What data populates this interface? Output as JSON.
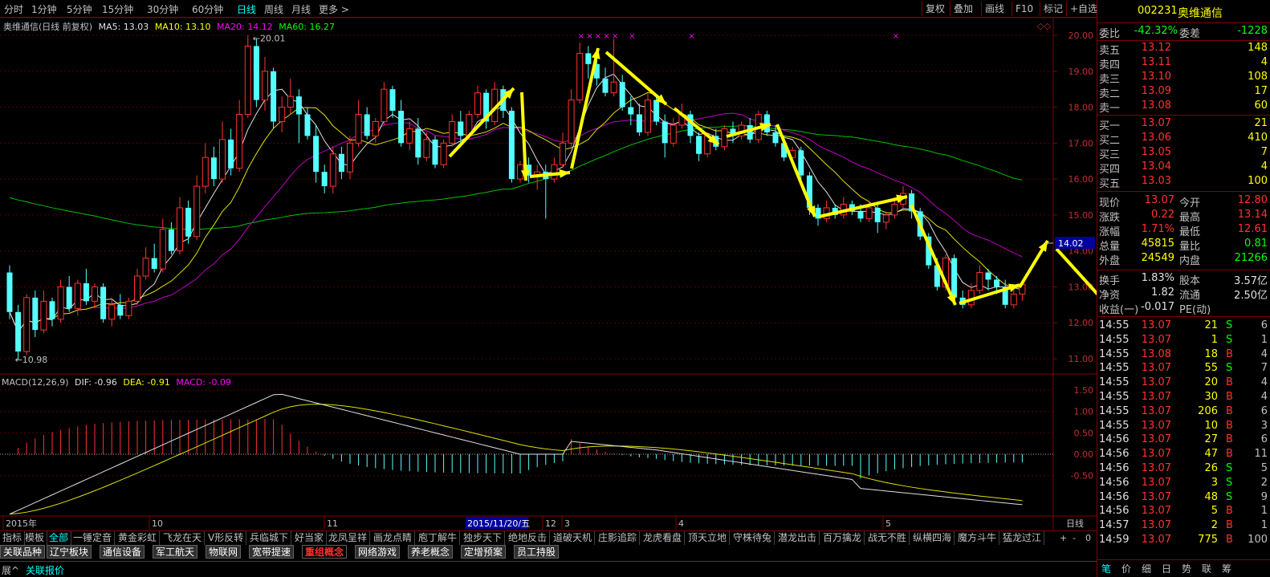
{
  "toolbar": {
    "periods": [
      "分时",
      "1分钟",
      "5分钟",
      "15分钟",
      "30分钟",
      "60分钟",
      "日线",
      "周线",
      "月线",
      "更多 >"
    ],
    "active": "日线",
    "right": [
      "复权",
      "叠加",
      "画线",
      "F10",
      "标记",
      "+自选"
    ]
  },
  "legend_main": {
    "name": "奥维通信(日线 前复权)",
    "ma5": "MA5: 13.03",
    "ma10": "MA10: 13.10",
    "ma20": "MA20: 14.12",
    "ma60": "MA60: 16.27"
  },
  "legend_macd": {
    "name": "MACD(12,26,9)",
    "dif": "DIF: -0.96",
    "dea": "DEA: -0.91",
    "macd": "MACD: -0.09"
  },
  "price_axis": [
    "20.00",
    "19.00",
    "18.00",
    "17.00",
    "16.00",
    "15.00",
    "14.00",
    "13.00",
    "12.00",
    "11.00"
  ],
  "macd_axis": [
    "1.50",
    "1.00",
    "0.50",
    "0.00",
    "-0.50"
  ],
  "cursor_price": "14.02",
  "chart_annotations": {
    "high": "20.01",
    "low": "10.98"
  },
  "date_axis": {
    "labels": [
      "2015年",
      "10",
      "11",
      "12",
      "3",
      "4",
      "5"
    ],
    "highlight": "2015/11/20/五",
    "period": "日线",
    "btns": [
      "+",
      "-",
      "0"
    ]
  },
  "chart_data": {
    "type": "candlestick",
    "price_range": [
      10.5,
      20.4
    ],
    "macd_range": [
      -1.2,
      1.75
    ],
    "candles": [
      [
        13.4,
        12.3,
        13.6,
        12.1
      ],
      [
        12.3,
        11.2,
        12.5,
        10.98
      ],
      [
        11.2,
        12.7,
        12.8,
        11.1
      ],
      [
        12.7,
        11.8,
        12.9,
        11.6
      ],
      [
        11.8,
        12.6,
        12.9,
        11.7
      ],
      [
        12.6,
        12.1,
        12.7,
        11.9
      ],
      [
        12.1,
        13.0,
        13.2,
        12.0
      ],
      [
        13.0,
        12.4,
        13.3,
        12.3
      ],
      [
        12.4,
        13.1,
        13.2,
        12.2
      ],
      [
        13.1,
        12.6,
        13.5,
        12.5
      ],
      [
        12.6,
        13.0,
        13.1,
        12.4
      ],
      [
        13.0,
        12.1,
        13.1,
        12.0
      ],
      [
        12.1,
        12.5,
        12.7,
        11.9
      ],
      [
        12.5,
        12.2,
        12.8,
        12.1
      ],
      [
        12.2,
        12.6,
        12.7,
        12.1
      ],
      [
        12.6,
        13.3,
        13.5,
        12.5
      ],
      [
        13.3,
        13.8,
        14.1,
        13.2
      ],
      [
        13.8,
        13.5,
        14.2,
        13.4
      ],
      [
        13.5,
        14.6,
        14.9,
        13.4
      ],
      [
        14.6,
        14.0,
        14.8,
        13.9
      ],
      [
        14.0,
        15.2,
        15.5,
        13.9
      ],
      [
        15.2,
        14.4,
        15.4,
        14.2
      ],
      [
        14.4,
        15.8,
        16.1,
        14.3
      ],
      [
        15.8,
        16.6,
        17.0,
        15.6
      ],
      [
        16.6,
        16.0,
        16.9,
        15.8
      ],
      [
        16.0,
        17.1,
        17.6,
        15.9
      ],
      [
        17.1,
        16.3,
        17.4,
        16.1
      ],
      [
        16.3,
        17.8,
        18.2,
        16.2
      ],
      [
        17.8,
        19.7,
        20.01,
        17.7
      ],
      [
        19.7,
        18.2,
        19.9,
        18.0
      ],
      [
        18.2,
        19.0,
        19.4,
        17.9
      ],
      [
        19.0,
        17.6,
        19.1,
        17.4
      ],
      [
        17.6,
        18.0,
        18.3,
        17.3
      ],
      [
        18.0,
        18.3,
        18.8,
        17.8
      ],
      [
        18.3,
        17.8,
        18.5,
        17.0
      ],
      [
        17.8,
        17.2,
        18.0,
        17.1
      ],
      [
        17.2,
        16.2,
        17.5,
        15.9
      ],
      [
        16.2,
        15.8,
        16.4,
        15.6
      ],
      [
        15.8,
        16.7,
        16.9,
        15.6
      ],
      [
        16.7,
        16.2,
        16.9,
        16.0
      ],
      [
        16.2,
        17.0,
        17.2,
        16.0
      ],
      [
        17.0,
        17.8,
        18.2,
        16.9
      ],
      [
        17.8,
        17.2,
        18.0,
        17.1
      ],
      [
        17.2,
        17.6,
        17.7,
        17.0
      ],
      [
        17.6,
        18.5,
        18.7,
        17.5
      ],
      [
        18.5,
        17.9,
        18.6,
        17.7
      ],
      [
        17.9,
        17.0,
        18.2,
        16.9
      ],
      [
        17.0,
        17.4,
        17.6,
        16.8
      ],
      [
        17.4,
        16.6,
        17.7,
        16.4
      ],
      [
        16.6,
        17.1,
        17.3,
        16.5
      ],
      [
        17.1,
        16.4,
        17.2,
        16.3
      ],
      [
        16.4,
        17.0,
        17.1,
        16.3
      ],
      [
        17.0,
        17.6,
        17.8,
        16.9
      ],
      [
        17.6,
        17.2,
        17.9,
        17.0
      ],
      [
        17.2,
        17.8,
        17.9,
        17.1
      ],
      [
        17.8,
        18.4,
        18.6,
        17.7
      ],
      [
        18.4,
        17.6,
        18.5,
        17.4
      ],
      [
        17.6,
        18.5,
        18.7,
        17.5
      ],
      [
        18.5,
        17.9,
        18.6,
        17.7
      ],
      [
        17.9,
        16.0,
        18.0,
        15.9
      ],
      [
        16.0,
        16.4,
        16.5,
        15.9
      ],
      [
        16.4,
        16.1,
        16.6,
        15.9
      ],
      [
        16.1,
        16.2,
        16.4,
        15.7
      ],
      [
        16.2,
        16.0,
        16.4,
        14.9
      ],
      [
        16.0,
        16.4,
        16.6,
        15.9
      ],
      [
        16.4,
        17.0,
        17.3,
        16.3
      ],
      [
        17.0,
        18.2,
        18.5,
        16.9
      ],
      [
        18.2,
        19.5,
        19.8,
        18.1
      ],
      [
        19.5,
        19.2,
        19.7,
        18.8
      ],
      [
        19.2,
        18.8,
        19.6,
        18.6
      ],
      [
        18.8,
        18.4,
        19.1,
        18.3
      ],
      [
        18.4,
        18.7,
        19.9,
        18.3
      ],
      [
        18.7,
        18.0,
        18.9,
        17.9
      ],
      [
        18.0,
        17.8,
        18.3,
        17.5
      ],
      [
        17.8,
        17.3,
        18.1,
        17.2
      ],
      [
        17.3,
        18.2,
        18.4,
        17.2
      ],
      [
        18.2,
        17.6,
        18.3,
        17.5
      ],
      [
        17.6,
        17.0,
        17.8,
        16.6
      ],
      [
        17.0,
        17.5,
        17.7,
        16.9
      ],
      [
        17.5,
        17.8,
        18.1,
        17.4
      ],
      [
        17.8,
        17.2,
        17.9,
        17.0
      ],
      [
        17.2,
        16.7,
        17.3,
        16.5
      ],
      [
        16.7,
        17.2,
        17.3,
        16.6
      ],
      [
        17.2,
        16.9,
        17.4,
        16.8
      ],
      [
        16.9,
        17.4,
        17.5,
        16.8
      ],
      [
        17.4,
        17.2,
        17.6,
        17.0
      ],
      [
        17.2,
        17.5,
        17.6,
        17.1
      ],
      [
        17.5,
        17.1,
        17.7,
        17.0
      ],
      [
        17.1,
        17.8,
        17.9,
        17.0
      ],
      [
        17.8,
        17.3,
        17.9,
        17.2
      ],
      [
        17.3,
        17.0,
        17.5,
        16.9
      ],
      [
        17.0,
        16.6,
        17.2,
        16.5
      ],
      [
        16.6,
        16.8,
        16.9,
        16.4
      ],
      [
        16.8,
        16.1,
        16.9,
        15.9
      ],
      [
        16.1,
        15.2,
        16.2,
        15.0
      ],
      [
        15.2,
        14.9,
        15.3,
        14.7
      ],
      [
        14.9,
        15.2,
        15.4,
        14.8
      ],
      [
        15.2,
        15.0,
        15.3,
        14.9
      ],
      [
        15.0,
        15.3,
        15.5,
        14.9
      ],
      [
        15.3,
        15.1,
        15.4,
        15.0
      ],
      [
        15.1,
        14.9,
        15.3,
        14.8
      ],
      [
        14.9,
        15.2,
        15.4,
        14.8
      ],
      [
        15.2,
        14.8,
        15.3,
        14.5
      ],
      [
        14.8,
        15.0,
        15.1,
        14.6
      ],
      [
        15.0,
        15.3,
        15.5,
        14.9
      ],
      [
        15.3,
        15.6,
        15.8,
        15.2
      ],
      [
        15.6,
        15.1,
        15.7,
        14.9
      ],
      [
        15.1,
        14.4,
        15.2,
        14.3
      ],
      [
        14.4,
        13.6,
        14.5,
        13.5
      ],
      [
        13.6,
        13.0,
        13.8,
        12.9
      ],
      [
        13.0,
        13.8,
        13.9,
        12.9
      ],
      [
        13.8,
        12.7,
        13.9,
        12.5
      ],
      [
        12.7,
        12.5,
        12.9,
        12.4
      ],
      [
        12.5,
        12.9,
        13.1,
        12.4
      ],
      [
        12.9,
        13.4,
        13.6,
        12.8
      ],
      [
        13.4,
        13.2,
        13.5,
        12.9
      ],
      [
        13.2,
        13.0,
        13.3,
        12.8
      ],
      [
        13.0,
        12.5,
        13.2,
        12.4
      ],
      [
        12.5,
        12.8,
        12.9,
        12.4
      ],
      [
        12.8,
        13.07,
        13.1,
        12.61
      ]
    ]
  },
  "right_panel": {
    "code": "002231",
    "name": "奥维通信",
    "weibi_label": "委比",
    "weibi": "-42.32%",
    "weicha_label": "委差",
    "weicha": "-1228",
    "asks": [
      {
        "label": "卖五",
        "price": "13.12",
        "vol": "148"
      },
      {
        "label": "卖四",
        "price": "13.11",
        "vol": "4"
      },
      {
        "label": "卖三",
        "price": "13.10",
        "vol": "108"
      },
      {
        "label": "卖二",
        "price": "13.09",
        "vol": "17"
      },
      {
        "label": "卖一",
        "price": "13.08",
        "vol": "60"
      }
    ],
    "bids": [
      {
        "label": "买一",
        "price": "13.07",
        "vol": "21"
      },
      {
        "label": "买二",
        "price": "13.06",
        "vol": "410"
      },
      {
        "label": "买三",
        "price": "13.05",
        "vol": "7"
      },
      {
        "label": "买四",
        "price": "13.04",
        "vol": "4"
      },
      {
        "label": "买五",
        "price": "13.03",
        "vol": "100"
      }
    ],
    "stats": [
      {
        "l1": "现价",
        "v1": "13.07",
        "l2": "今开",
        "v2": "12.80"
      },
      {
        "l1": "涨跌",
        "v1": "0.22",
        "l2": "最高",
        "v2": "13.14"
      },
      {
        "l1": "涨幅",
        "v1": "1.71%",
        "l2": "最低",
        "v2": "12.61"
      },
      {
        "l1": "总量",
        "v1": "45815",
        "l2": "量比",
        "v2": "0.81"
      },
      {
        "l1": "外盘",
        "v1": "24549",
        "l2": "内盘",
        "v2": "21266"
      }
    ],
    "stats2": [
      {
        "l1": "换手",
        "v1": "1.83%",
        "l2": "股本",
        "v2": "3.57亿"
      },
      {
        "l1": "净资",
        "v1": "1.82",
        "l2": "流通",
        "v2": "2.50亿"
      },
      {
        "l1": "收益(一)",
        "v1": "-0.017",
        "l2": "PE(动)",
        "v2": ""
      }
    ],
    "trades": [
      {
        "t": "14:55",
        "p": "13.07",
        "v": "21",
        "s": "S",
        "n": "6"
      },
      {
        "t": "14:55",
        "p": "13.07",
        "v": "1",
        "s": "S",
        "n": "1"
      },
      {
        "t": "14:55",
        "p": "13.08",
        "v": "18",
        "s": "B",
        "n": "4"
      },
      {
        "t": "14:55",
        "p": "13.07",
        "v": "55",
        "s": "S",
        "n": "7"
      },
      {
        "t": "14:55",
        "p": "13.07",
        "v": "20",
        "s": "B",
        "n": "4"
      },
      {
        "t": "14:55",
        "p": "13.07",
        "v": "30",
        "s": "B",
        "n": "4"
      },
      {
        "t": "14:55",
        "p": "13.07",
        "v": "206",
        "s": "B",
        "n": "6"
      },
      {
        "t": "14:55",
        "p": "13.07",
        "v": "10",
        "s": "B",
        "n": "3"
      },
      {
        "t": "14:56",
        "p": "13.07",
        "v": "27",
        "s": "B",
        "n": "6"
      },
      {
        "t": "14:56",
        "p": "13.07",
        "v": "47",
        "s": "B",
        "n": "11"
      },
      {
        "t": "14:56",
        "p": "13.07",
        "v": "26",
        "s": "S",
        "n": "5"
      },
      {
        "t": "14:56",
        "p": "13.07",
        "v": "3",
        "s": "S",
        "n": "2"
      },
      {
        "t": "14:56",
        "p": "13.07",
        "v": "48",
        "s": "S",
        "n": "9"
      },
      {
        "t": "14:56",
        "p": "13.07",
        "v": "5",
        "s": "B",
        "n": "1"
      },
      {
        "t": "14:57",
        "p": "13.07",
        "v": "2",
        "s": "B",
        "n": "1"
      },
      {
        "t": "14:59",
        "p": "13.07",
        "v": "775",
        "s": "B",
        "n": "100"
      }
    ],
    "bottom_tabs": [
      "笔",
      "价",
      "细",
      "日",
      "势",
      "联",
      "筹"
    ]
  },
  "indicator_tabs": [
    "指标",
    "模板",
    "全部",
    "一锤定音",
    "黄金彩虹",
    "飞龙在天",
    "V形反转",
    "兵临城下",
    "好当家",
    "龙凤呈祥",
    "画龙点睛",
    "庖丁解牛",
    "独步天下",
    "绝地反击",
    "道破天机",
    "庄影追踪",
    "龙虎看盘",
    "顶天立地",
    "守株待兔",
    "潜龙出击",
    "百万擒龙",
    "战无不胜",
    "纵横四海",
    "魔方斗牛",
    "猛龙过江"
  ],
  "indicator_active": "全部",
  "sector_tabs": [
    "关联品种",
    "辽宁板块",
    "通信设备",
    "军工航天",
    "物联网",
    "宽带提速",
    "重组概念",
    "网络游戏",
    "养老概念",
    "定增预案",
    "员工持股"
  ],
  "sector_active": "重组概念",
  "status": {
    "left": "展^",
    "label": "关联报价"
  }
}
